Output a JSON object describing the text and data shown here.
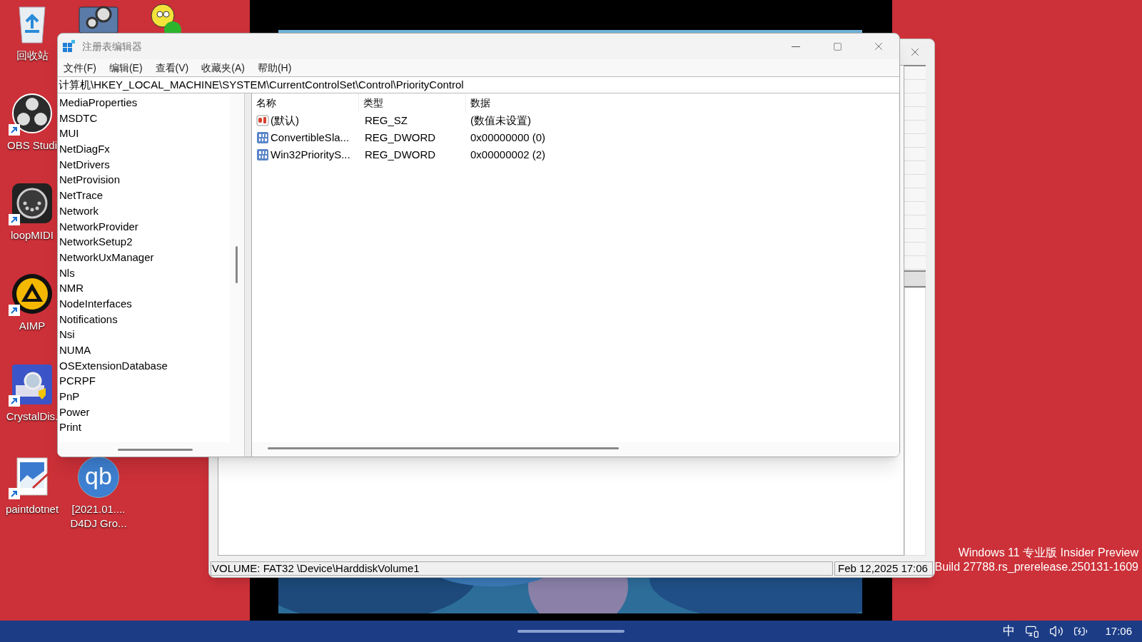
{
  "desktop": {
    "icons": [
      {
        "kind": "recycle",
        "label": "回收站"
      },
      {
        "kind": "obs",
        "label": "OBS Studi"
      },
      {
        "kind": "midi",
        "label": "loopMIDI"
      },
      {
        "kind": "aimp",
        "label": "AIMP"
      },
      {
        "kind": "crystaldisk",
        "label": "CrystalDis."
      },
      {
        "kind": "paint",
        "label": "paintdotnet"
      },
      {
        "kind": "settings"
      },
      {
        "kind": "qbittorrent",
        "glyph": "qb",
        "label": "[2021.01....\nD4DJ Gro..."
      },
      {
        "kind": "bird"
      }
    ],
    "build_info": [
      "Windows 11 专业版 Insider Preview",
      "Build 27788.rs_prerelease.250131-1609"
    ]
  },
  "disk_window": {
    "status_bar": [
      "VOLUME:  FAT32 \\Device\\HarddiskVolume1",
      "Feb 12,2025 17:06"
    ]
  },
  "regedit": {
    "title": "注册表编辑器",
    "menu": [
      "文件(F)",
      "编辑(E)",
      "查看(V)",
      "收藏夹(A)",
      "帮助(H)"
    ],
    "address": "计算机\\HKEY_LOCAL_MACHINE\\SYSTEM\\CurrentControlSet\\Control\\PriorityControl",
    "tree": [
      "MediaProperties",
      "MSDTC",
      "MUI",
      "NetDiagFx",
      "NetDrivers",
      "NetProvision",
      "NetTrace",
      "Network",
      "NetworkProvider",
      "NetworkSetup2",
      "NetworkUxManager",
      "Nls",
      "NMR",
      "NodeInterfaces",
      "Notifications",
      "Nsi",
      "NUMA",
      "OSExtensionDatabase",
      "PCRPF",
      "PnP",
      "Power",
      "Print"
    ],
    "columns": [
      "名称",
      "类型",
      "数据"
    ],
    "values": [
      {
        "kind": "string",
        "name": "(默认)",
        "type": "REG_SZ",
        "data": "(数值未设置)"
      },
      {
        "kind": "dword",
        "name": "ConvertibleSla...",
        "type": "REG_DWORD",
        "data": "0x00000000 (0)"
      },
      {
        "kind": "dword",
        "name": "Win32PriorityS...",
        "type": "REG_DWORD",
        "data": "0x00000002 (2)"
      }
    ]
  },
  "taskbar": {
    "ime": "中",
    "time": "17:06"
  }
}
